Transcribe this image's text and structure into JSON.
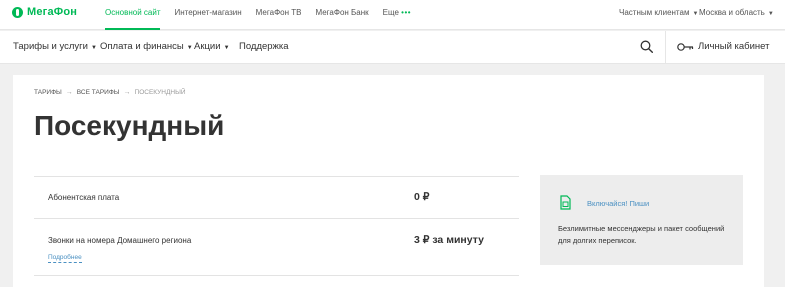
{
  "brand": {
    "name": "МегаФон",
    "accent_color": "#00b956",
    "link_color": "#4a90c2"
  },
  "topbar": {
    "nav": [
      {
        "label": "Основной сайт",
        "active": true
      },
      {
        "label": "Интернет-магазин",
        "active": false
      },
      {
        "label": "МегаФон ТВ",
        "active": false
      },
      {
        "label": "МегаФон Банк",
        "active": false
      },
      {
        "label": "Еще",
        "active": false
      }
    ],
    "more_dots": "•••",
    "client_type": "Частным клиентам",
    "region": "Москва и область"
  },
  "mainnav": {
    "items": [
      {
        "label": "Тарифы и услуги",
        "has_dropdown": true
      },
      {
        "label": "Оплата и финансы",
        "has_dropdown": true
      },
      {
        "label": "Акции",
        "has_dropdown": true
      },
      {
        "label": "Поддержка",
        "has_dropdown": false
      }
    ],
    "search_icon": "search-icon",
    "cabinet_icon": "key-icon",
    "cabinet_label": "Личный кабинет"
  },
  "breadcrumb": {
    "items": [
      "ТАРИФЫ",
      "ВСЕ ТАРИФЫ",
      "ПОСЕКУНДНЫЙ"
    ],
    "separator": "→"
  },
  "page": {
    "title": "Посекундный"
  },
  "tariff": {
    "rows": [
      {
        "label": "Абонентская плата",
        "value": "0 ₽"
      },
      {
        "label": "Звонки на номера Домашнего региона",
        "value": "3 ₽ за минуту"
      }
    ],
    "more_link": "Подробнее"
  },
  "promo": {
    "icon": "sim-card-icon",
    "link": "Включайся! Пиши",
    "text": "Безлимитные мессенджеры и пакет сообщений для долгих переписок."
  }
}
